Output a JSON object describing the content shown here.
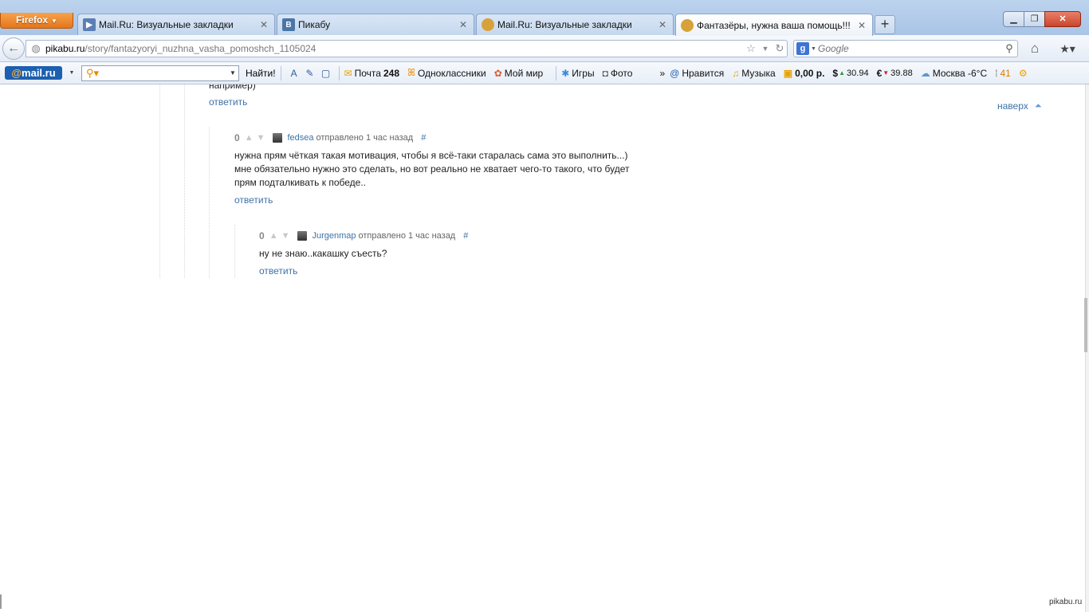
{
  "browser": {
    "menu_button": "Firefox",
    "tabs": [
      {
        "label": "Mail.Ru: Визуальные закладки",
        "icon": "video-tab-icon"
      },
      {
        "label": "Пикабу",
        "icon": "vk-tab-icon"
      },
      {
        "label": "Mail.Ru: Визуальные закладки",
        "icon": "pikabu-tab-icon"
      },
      {
        "label": "Фантазёры, нужна ваша помощь!!!",
        "icon": "pikabu-tab-icon"
      }
    ],
    "url_host": "pikabu.ru",
    "url_path": "/story/fantazyoryi_nuzhna_vasha_pomoshch_1105024",
    "search_placeholder": "Google"
  },
  "mailru_toolbar": {
    "logo_at": "@",
    "logo": "mail.ru",
    "find_label": "Найти!",
    "items": [
      {
        "label": "Почта",
        "count": "248"
      },
      {
        "label": "Одноклассники"
      },
      {
        "label": "Мой мир"
      },
      {
        "label": "Игры"
      },
      {
        "label": "Фото"
      },
      {
        "label": "Нравится"
      },
      {
        "label": "Музыка"
      },
      {
        "label": "0,00 р."
      }
    ],
    "usd": "30.94",
    "eur": "39.88",
    "weather": "Москва -6°C",
    "traffic": "41"
  },
  "page": {
    "prev_comment_tail": "например)",
    "reply_label": "ответить",
    "back_to_top": "наверх",
    "comments": [
      {
        "rating": "0",
        "author": "fedsea",
        "meta": "отправлено 1 час назад",
        "hash": "#",
        "lines": [
          "нужна прям чёткая такая мотивация, чтобы я всё-таки старалась сама это выполнить...)",
          "мне обязательно нужно это сделать, но вот реально не хватает чего-то такого, что будет",
          "прям подталкивать к победе.."
        ]
      },
      {
        "rating": "0",
        "author": "Jurgenmap",
        "meta": "отправлено 1 час назад",
        "hash": "#",
        "lines": [
          "ну не знаю..какашку съесть?"
        ]
      }
    ]
  },
  "watermark": "pikabu.ru"
}
